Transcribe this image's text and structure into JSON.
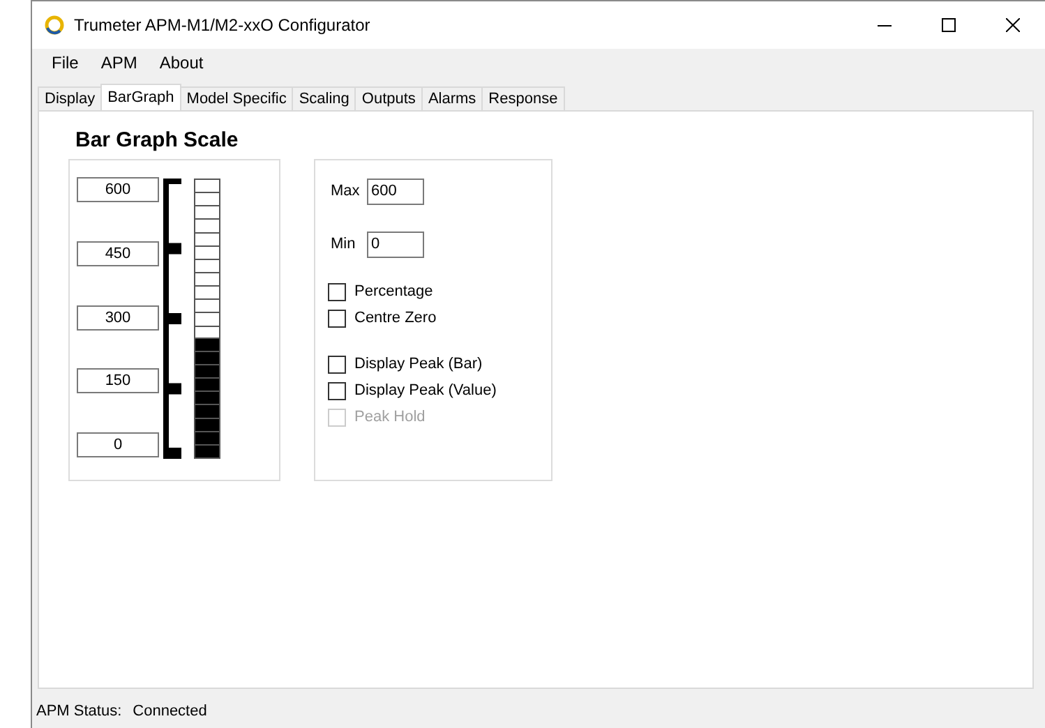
{
  "window": {
    "title": "Trumeter APM-M1/M2-xxO Configurator"
  },
  "menu": [
    "File",
    "APM",
    "About"
  ],
  "tabs": [
    {
      "label": "Display",
      "selected": false
    },
    {
      "label": "BarGraph",
      "selected": true
    },
    {
      "label": "Model Specific",
      "selected": false
    },
    {
      "label": "Scaling",
      "selected": false
    },
    {
      "label": "Outputs",
      "selected": false
    },
    {
      "label": "Alarms",
      "selected": false
    },
    {
      "label": "Response",
      "selected": false
    }
  ],
  "heading": "Bar Graph Scale",
  "bar_graph": {
    "scale_labels": [
      "600",
      "450",
      "300",
      "150",
      "0"
    ],
    "level": 0.43
  },
  "fields": [
    {
      "label": "Max",
      "value": "600"
    },
    {
      "label": "Min",
      "value": "0"
    }
  ],
  "checkbox_groups": [
    [
      {
        "label": "Percentage",
        "checked": false,
        "disabled": false
      },
      {
        "label": "Centre Zero",
        "checked": false,
        "disabled": false
      }
    ],
    [
      {
        "label": "Display Peak (Bar)",
        "checked": false,
        "disabled": false
      },
      {
        "label": "Display Peak (Value)",
        "checked": false,
        "disabled": false
      },
      {
        "label": "Peak Hold",
        "checked": false,
        "disabled": true
      }
    ]
  ],
  "status_bar": {
    "label": "APM Status:",
    "value": "Connected"
  }
}
